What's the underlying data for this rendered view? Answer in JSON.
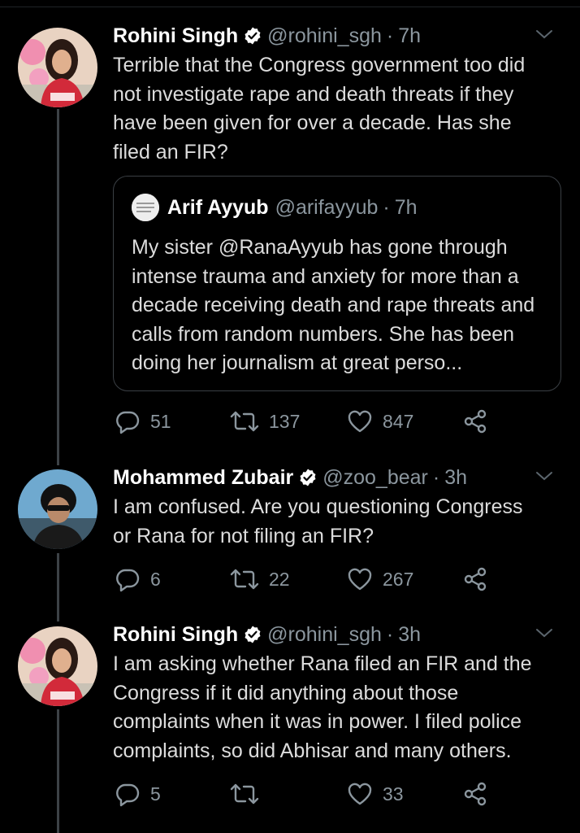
{
  "tweets": [
    {
      "name": "Rohini Singh",
      "handle": "@rohini_sgh",
      "separator": "·",
      "time": "7h",
      "text": "Terrible that the Congress government too did\nnot investigate rape and death threats if they\nhave been given for over a decade. Has she\nfiled an FIR?",
      "quote": {
        "name": "Arif Ayyub",
        "handle": "@arifayyub",
        "separator": "·",
        "time": "7h",
        "text": "My sister @RanaAyyub has gone through\nintense trauma and anxiety for more than\na decade receiving death and rape threats\nand calls from random numbers. She has\nbeen doing her journalism at great perso..."
      },
      "replies": "51",
      "retweets": "137",
      "likes": "847"
    },
    {
      "name": "Mohammed Zubair",
      "handle": "@zoo_bear",
      "separator": "·",
      "time": "3h",
      "text": "I am confused. Are you questioning Congress\nor Rana for not filing an FIR?",
      "replies": "6",
      "retweets": "22",
      "likes": "267"
    },
    {
      "name": "Rohini Singh",
      "handle": "@rohini_sgh",
      "separator": "·",
      "time": "3h",
      "text": "I am asking whether Rana filed an FIR and the\nCongress if it did anything about those\ncomplaints when it was in power. I filed police\ncomplaints, so did Abhisar and many others.",
      "replies": "5",
      "retweets": "",
      "likes": "33"
    }
  ],
  "icons": {
    "reply": "reply-icon",
    "retweet": "retweet-icon",
    "like": "heart-icon",
    "share": "share-icon",
    "verified": "verified-badge-icon",
    "more": "chevron-down-icon"
  },
  "colors": {
    "background": "#000000",
    "secondary_text": "#8b969e",
    "thread_line": "#3d4246"
  }
}
